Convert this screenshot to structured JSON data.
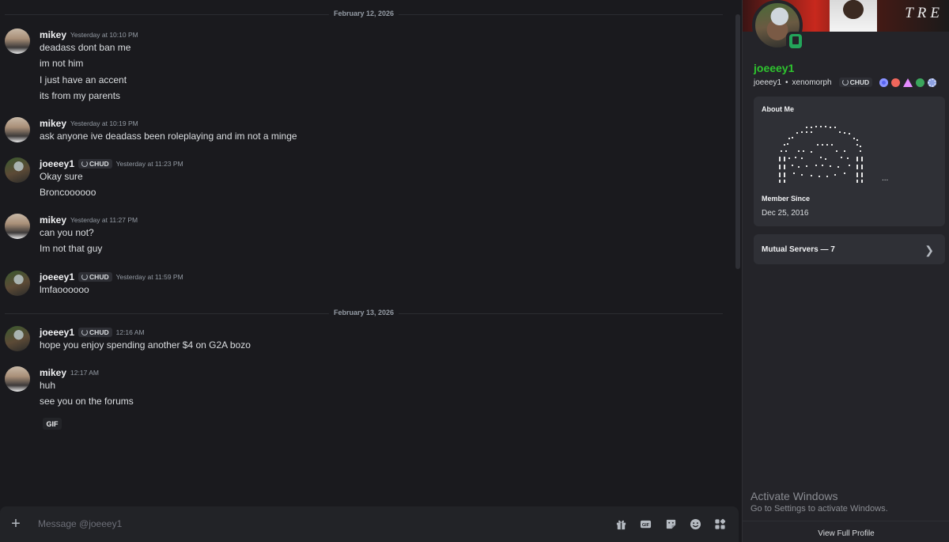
{
  "chat": {
    "dividers": [
      "February 12, 2026",
      "February 13, 2026"
    ],
    "gif_label": "GIF",
    "groups": [
      {
        "author": "mikey",
        "time": "Yesterday at 10:10 PM",
        "lines": [
          "deadass dont ban me",
          "im not him",
          "I just have an accent",
          "its from my parents"
        ]
      },
      {
        "author": "mikey",
        "time": "Yesterday at 10:19 PM",
        "lines": [
          "ask anyone ive deadass been roleplaying and im not a minge"
        ]
      },
      {
        "author": "joeeey1",
        "tag": "CHUD",
        "time": "Yesterday at 11:23 PM",
        "lines": [
          "Okay sure",
          "Broncoooooo"
        ]
      },
      {
        "author": "mikey",
        "time": "Yesterday at 11:27 PM",
        "lines": [
          "can you not?",
          "Im not that guy"
        ]
      },
      {
        "author": "joeeey1",
        "tag": "CHUD",
        "time": "Yesterday at 11:59 PM",
        "lines": [
          "lmfaoooooo"
        ]
      },
      {
        "author": "joeeey1",
        "tag": "CHUD",
        "time": "12:16 AM",
        "lines": [
          "hope you enjoy spending another $4 on G2A bozo"
        ]
      },
      {
        "author": "mikey",
        "time": "12:17 AM",
        "lines": [
          "huh",
          "see you on the forums"
        ]
      }
    ]
  },
  "input": {
    "placeholder": "Message @joeeey1",
    "icons": [
      "plus-icon",
      "gift-icon",
      "gif-icon",
      "sticker-icon",
      "emoji-icon",
      "apps-icon"
    ]
  },
  "profile": {
    "banner_text": "TRE",
    "display_name": "joeeey1",
    "display_name_color": "#2ec52e",
    "username": "joeeey1",
    "pronouns": "xenomorph",
    "tag": "CHUD",
    "badge_colors": [
      "#5865f2",
      "#f0675c",
      "#e58bff",
      "#3ba55c",
      "#8ea1e1"
    ],
    "about_me_title": "About Me",
    "about_me_ellipsis": "...",
    "member_since_title": "Member Since",
    "member_since": "Dec 25, 2016",
    "mutual_servers": "Mutual Servers — 7",
    "view_full_profile": "View Full Profile"
  },
  "watermark": {
    "title": "Activate Windows",
    "subtitle": "Go to Settings to activate Windows."
  }
}
